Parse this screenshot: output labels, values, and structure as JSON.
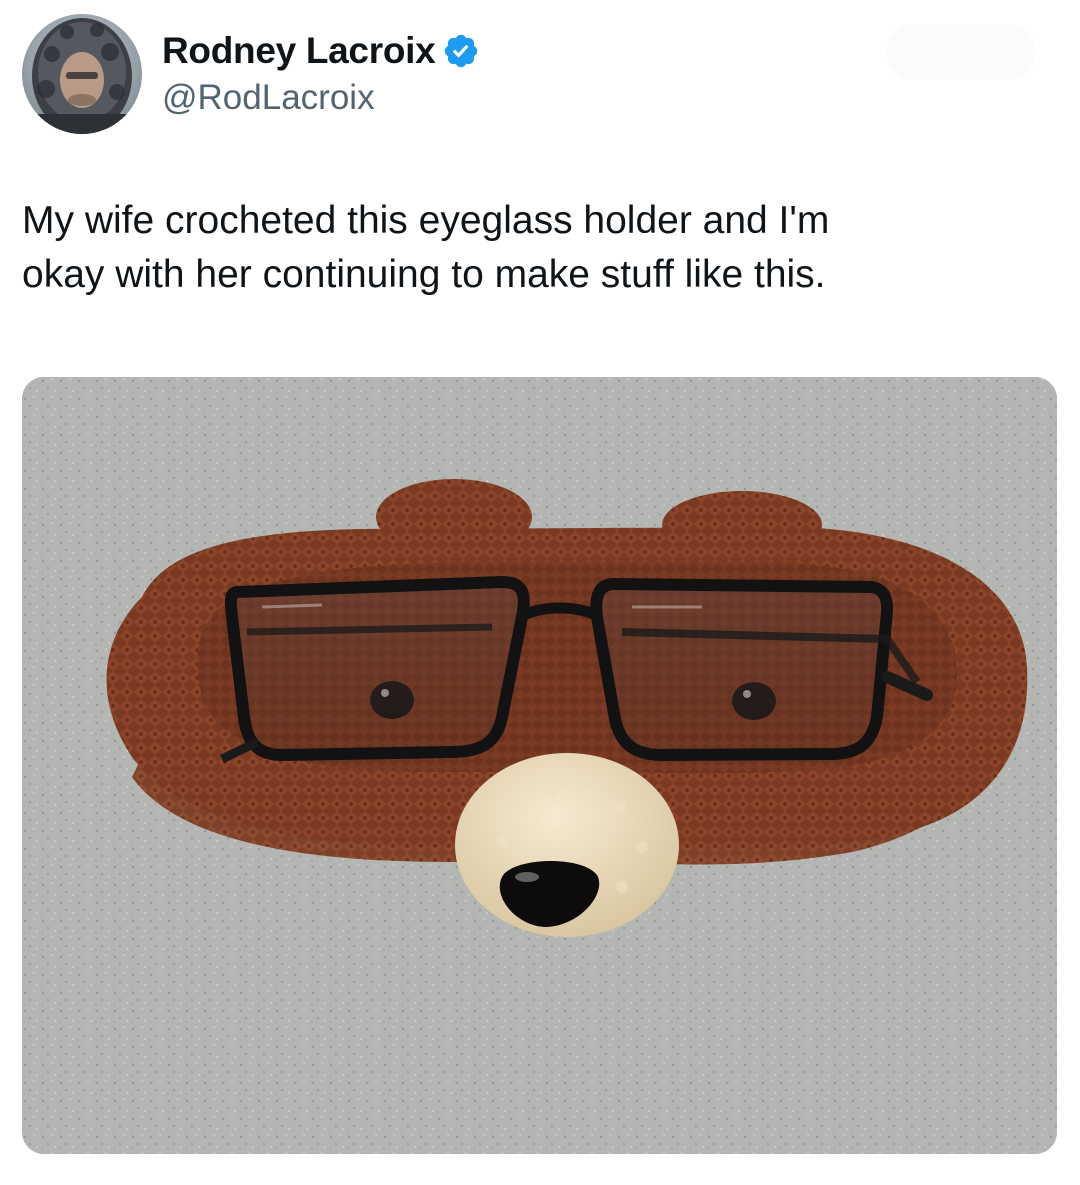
{
  "author": {
    "display_name": "Rodney Lacroix",
    "handle": "@RodLacroix",
    "verified": true,
    "verified_icon": "verified-badge-icon",
    "verified_color": "#1d9bf0"
  },
  "tweet": {
    "text_line_1": "My wife crocheted this eyeglass holder and I'm",
    "text_line_2": "okay with her continuing to make stuff like this."
  },
  "media": {
    "alt": "Crocheted brown bear-face eyeglass holder with a pair of black glasses resting in it"
  },
  "colors": {
    "text_primary": "#0f1419",
    "text_secondary": "#536471"
  }
}
